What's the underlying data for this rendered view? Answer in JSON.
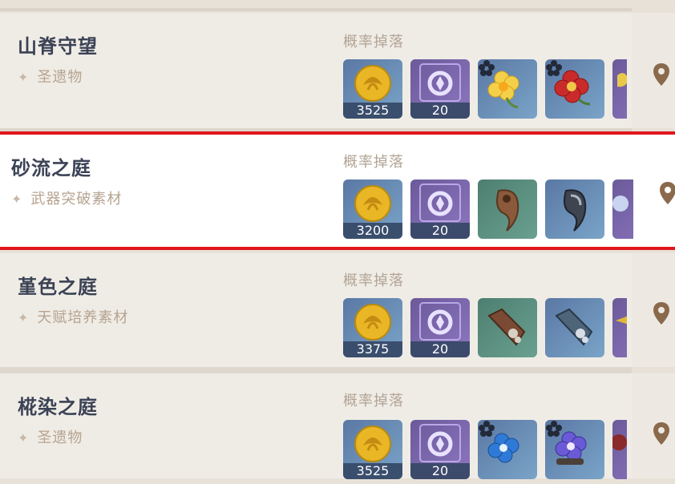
{
  "drop_label": "概率掉落",
  "rows": [
    {
      "title": "山脊守望",
      "subtitle": "圣遗物",
      "mora": "3525",
      "exp": "20"
    },
    {
      "title": "砂流之庭",
      "subtitle": "武器突破素材",
      "mora": "3200",
      "exp": "20"
    },
    {
      "title": "堇色之庭",
      "subtitle": "天赋培养素材",
      "mora": "3375",
      "exp": "20"
    },
    {
      "title": "椛染之庭",
      "subtitle": "圣遗物",
      "mora": "3525",
      "exp": "20"
    }
  ],
  "colors": {
    "selected_border": "#e0171c",
    "title": "#3b4255",
    "subtitle": "#b6a38f",
    "pin": "#8a6a4c"
  }
}
